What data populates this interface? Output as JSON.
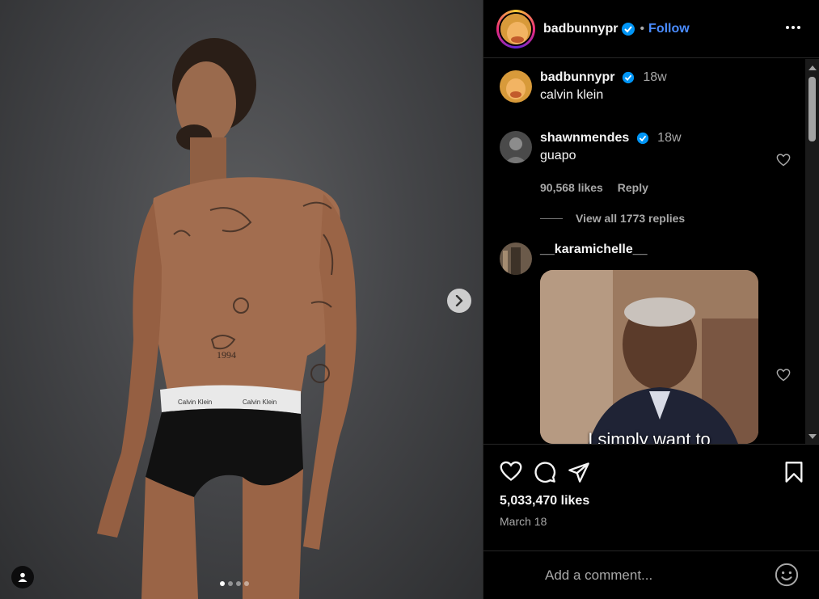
{
  "media": {
    "photo_label": "Calvin Klein",
    "carousel_count": 4,
    "active_index": 0
  },
  "header": {
    "username": "badbunnypr",
    "bullet": "•",
    "follow_label": "Follow"
  },
  "caption": {
    "username": "badbunnypr",
    "time": "18w",
    "text": "calvin klein"
  },
  "comments": [
    {
      "username": "shawnmendes",
      "time": "18w",
      "text": "guapo",
      "likes": "90,568 likes",
      "reply_label": "Reply",
      "view_replies": "View all 1773 replies"
    },
    {
      "username": "__karamichelle__",
      "gif_caption": "I simply want to"
    }
  ],
  "post": {
    "likes": "5,033,470 likes",
    "date": "March 18"
  },
  "comment_input": {
    "placeholder": "Add a comment..."
  },
  "colors": {
    "accent": "#4a8cff",
    "background": "#000000",
    "muted_text": "#a8a8a8",
    "verified": "#0095f6"
  },
  "icons": [
    "verified-icon",
    "more-icon",
    "heart-icon",
    "comment-icon",
    "share-icon",
    "bookmark-icon",
    "emoji-icon",
    "chevron-right-icon",
    "user-tag-icon"
  ]
}
